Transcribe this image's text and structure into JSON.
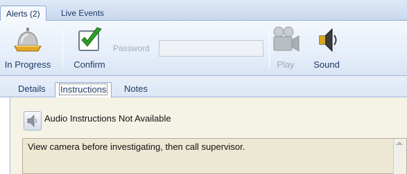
{
  "top_tabs": [
    {
      "label": "Alerts (2)",
      "active": true
    },
    {
      "label": "Live Events",
      "active": false
    }
  ],
  "toolbar": {
    "in_progress_label": "In Progress",
    "confirm_label": "Confirm",
    "password_label": "Password",
    "password_value": "",
    "play_label": "Play",
    "sound_label": "Sound"
  },
  "sub_tabs": [
    {
      "label": "Details",
      "active": false
    },
    {
      "label": "Instructions",
      "active": true
    },
    {
      "label": "Notes",
      "active": false
    }
  ],
  "instructions": {
    "audio_status": "Audio Instructions Not Available",
    "text": "View camera before investigating, then call supervisor."
  },
  "colors": {
    "toolbar_bg": "#e6eef9",
    "content_bg": "#f5f2e6",
    "instructions_bg": "#ede8d3",
    "confirm_check": "#2e9b2a",
    "accent_text": "#1f3a66"
  },
  "icons": {
    "in_progress": "service-bell-icon",
    "confirm": "checkbox-check-icon",
    "play": "video-camera-icon",
    "sound": "speaker-icon",
    "audio_instructions": "speaker-icon"
  }
}
